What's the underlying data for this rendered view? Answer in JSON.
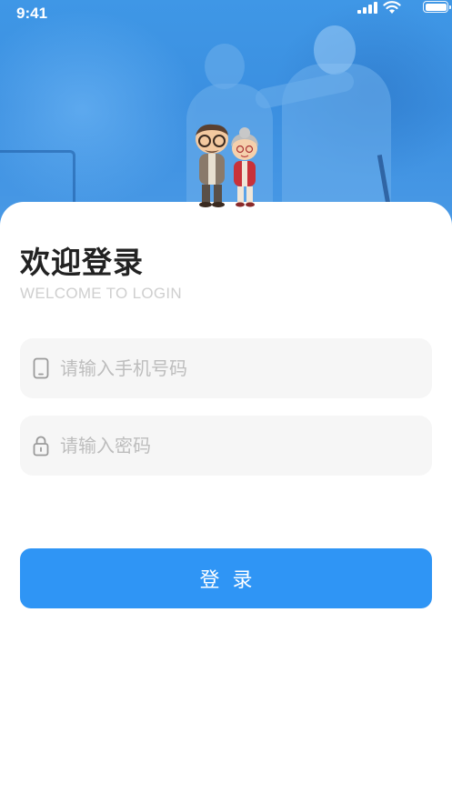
{
  "status_bar": {
    "time": "9:41",
    "icons": [
      "signal-icon",
      "wifi-icon",
      "battery-icon"
    ]
  },
  "hero": {
    "image": "elderly-couple-walking-photo",
    "illustration": "cartoon-elderly-couple"
  },
  "login": {
    "title": "欢迎登录",
    "subtitle": "WELCOME TO LOGIN",
    "phone_placeholder": "请输入手机号码",
    "phone_value": "",
    "password_placeholder": "请输入密码",
    "password_value": "",
    "submit_label": "登录"
  },
  "colors": {
    "primary": "#2f95f5",
    "hero_blue": "#3f97e6",
    "field_bg": "#f6f6f6",
    "title": "#222222",
    "subtitle": "#cfcfcf",
    "placeholder": "#bdbdbd"
  }
}
